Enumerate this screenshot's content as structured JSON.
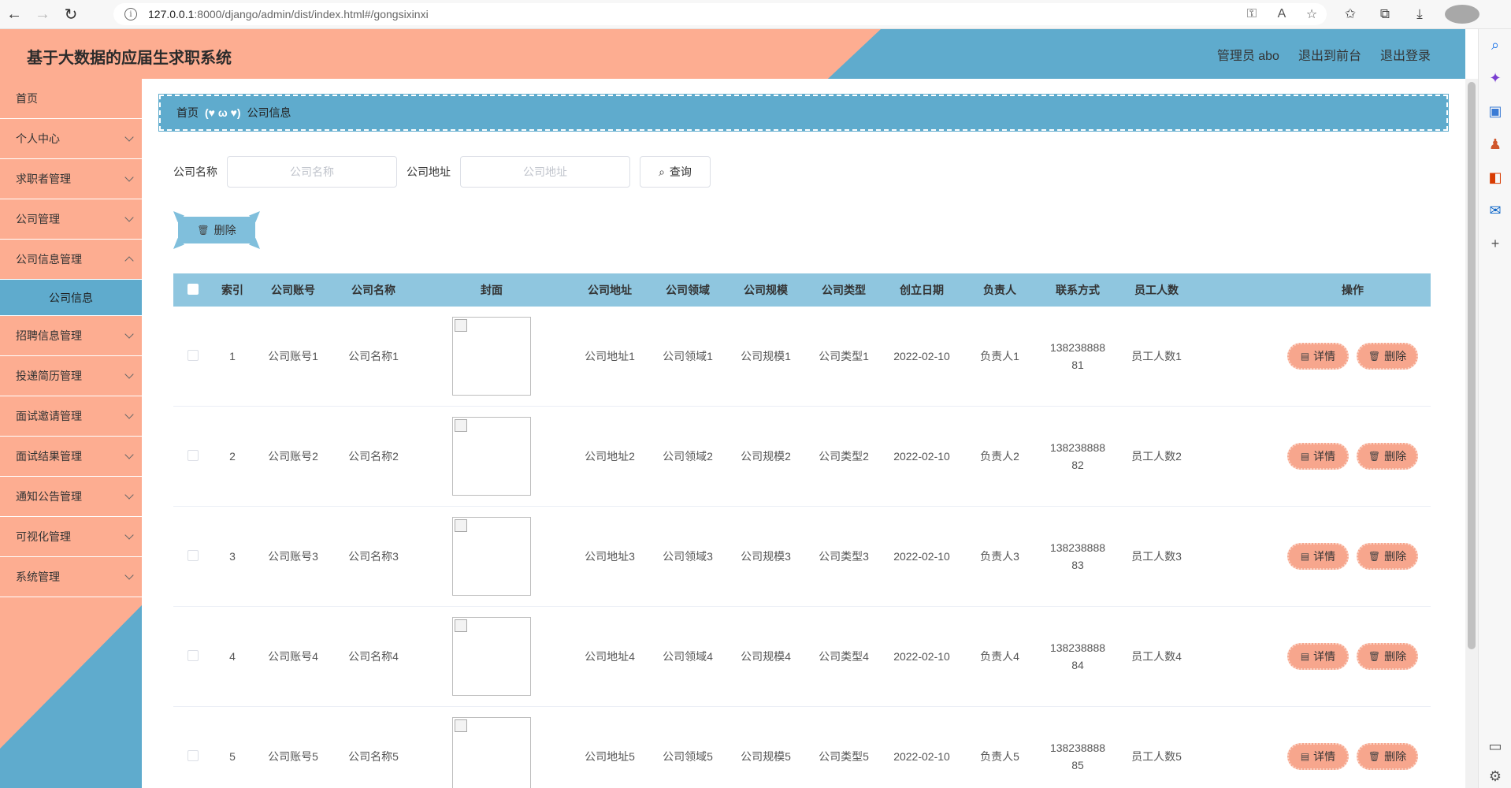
{
  "browser": {
    "url_host": "127.0.0.1",
    "url_rest": ":8000/django/admin/dist/index.html#/gongsixinxi"
  },
  "app": {
    "title": "基于大数据的应届生求职系统",
    "header_links": [
      "管理员 abo",
      "退出到前台",
      "退出登录"
    ]
  },
  "menu": {
    "items": [
      {
        "label": "首页",
        "chevron": false
      },
      {
        "label": "个人中心",
        "chevron": true
      },
      {
        "label": "求职者管理",
        "chevron": true
      },
      {
        "label": "公司管理",
        "chevron": true
      },
      {
        "label": "公司信息管理",
        "chevron": true,
        "expanded": true
      },
      {
        "label": "招聘信息管理",
        "chevron": true
      },
      {
        "label": "投递简历管理",
        "chevron": true
      },
      {
        "label": "面试邀请管理",
        "chevron": true
      },
      {
        "label": "面试结果管理",
        "chevron": true
      },
      {
        "label": "通知公告管理",
        "chevron": true
      },
      {
        "label": "可视化管理",
        "chevron": true
      },
      {
        "label": "系统管理",
        "chevron": true
      }
    ],
    "active_sub": "公司信息"
  },
  "breadcrumb": {
    "home": "首页",
    "separator": "(♥ ω ♥)",
    "current": "公司信息"
  },
  "search": {
    "name_label": "公司名称",
    "name_placeholder": "公司名称",
    "addr_label": "公司地址",
    "addr_placeholder": "公司地址",
    "query_label": "查询"
  },
  "toolbar": {
    "delete_label": "删除"
  },
  "table": {
    "headers": [
      "索引",
      "公司账号",
      "公司名称",
      "封面",
      "公司地址",
      "公司领域",
      "公司规模",
      "公司类型",
      "创立日期",
      "负责人",
      "联系方式",
      "员工人数",
      "操作"
    ],
    "rows": [
      {
        "idx": "1",
        "account": "公司账号1",
        "name": "公司名称1",
        "addr": "公司地址1",
        "field": "公司领域1",
        "scale": "公司规模1",
        "type": "公司类型1",
        "date": "2022-02-10",
        "person": "负责人1",
        "phone1": "138238888",
        "phone2": "81",
        "staff": "员工人数1"
      },
      {
        "idx": "2",
        "account": "公司账号2",
        "name": "公司名称2",
        "addr": "公司地址2",
        "field": "公司领域2",
        "scale": "公司规模2",
        "type": "公司类型2",
        "date": "2022-02-10",
        "person": "负责人2",
        "phone1": "138238888",
        "phone2": "82",
        "staff": "员工人数2"
      },
      {
        "idx": "3",
        "account": "公司账号3",
        "name": "公司名称3",
        "addr": "公司地址3",
        "field": "公司领域3",
        "scale": "公司规模3",
        "type": "公司类型3",
        "date": "2022-02-10",
        "person": "负责人3",
        "phone1": "138238888",
        "phone2": "83",
        "staff": "员工人数3"
      },
      {
        "idx": "4",
        "account": "公司账号4",
        "name": "公司名称4",
        "addr": "公司地址4",
        "field": "公司领域4",
        "scale": "公司规模4",
        "type": "公司类型4",
        "date": "2022-02-10",
        "person": "负责人4",
        "phone1": "138238888",
        "phone2": "84",
        "staff": "员工人数4"
      },
      {
        "idx": "5",
        "account": "公司账号5",
        "name": "公司名称5",
        "addr": "公司地址5",
        "field": "公司领域5",
        "scale": "公司规模5",
        "type": "公司类型5",
        "date": "2022-02-10",
        "person": "负责人5",
        "phone1": "138238888",
        "phone2": "85",
        "staff": "员工人数5"
      }
    ],
    "detail_label": "详情",
    "delete_label": "删除"
  },
  "colors": {
    "salmon": "#fdad91",
    "blue": "#5fabcd",
    "header_blue": "#8fc6df",
    "op_button": "#f7a68d"
  }
}
